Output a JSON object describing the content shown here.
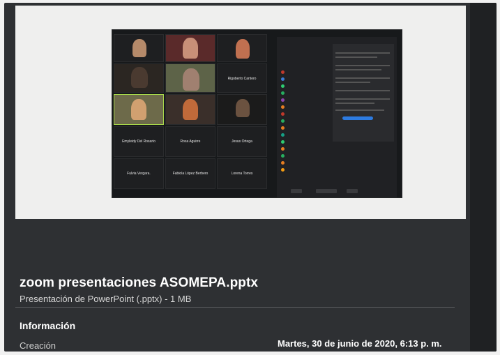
{
  "file": {
    "name": "zoom presentaciones ASOMEPA.pptx",
    "type_label": "Presentación de PowerPoint (.pptx) - 1 MB"
  },
  "info": {
    "heading": "Información",
    "created_label": "Creación",
    "created_value": "Martes, 30 de junio de 2020, 6:13 p. m."
  },
  "slide": {
    "grid_names": [
      "Rigoberto Cantero",
      "Emyleidy Del Rosario",
      "Rosa Aguirre",
      "Jesus Ortega",
      "Fulvia Vergara.",
      "Fabiola López Berbero",
      "Lorena Torres"
    ]
  }
}
